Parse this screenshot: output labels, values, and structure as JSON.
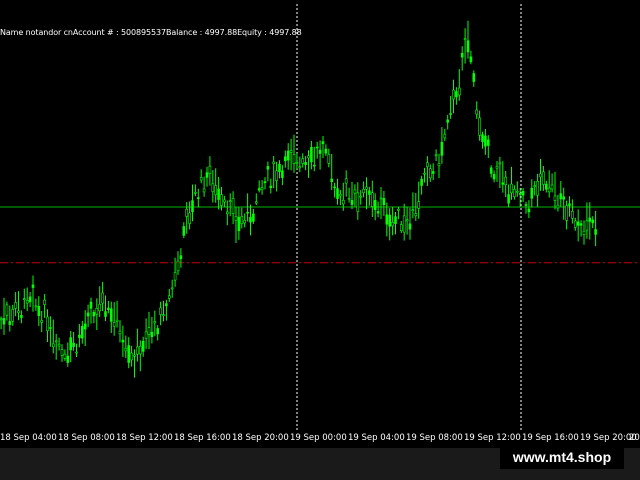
{
  "account_info": {
    "name_label": "Name",
    "name_value": "notandor cn",
    "account_label": "Account #",
    "account_value": "500895537",
    "balance_label": "Balance",
    "balance_value": "4997.88",
    "equity_label": "Equity",
    "equity_value": "4997.88"
  },
  "watermark": "www.mt4.shop",
  "colors": {
    "background": "#000000",
    "candles": "#00ff00",
    "horizontal_line": "#00b400",
    "level_line": "#cc0000",
    "grid_marker": "#ffffff"
  },
  "chart_data": {
    "type": "line",
    "x_ticks": [
      "18 Sep 04:00",
      "18 Sep 08:00",
      "18 Sep 12:00",
      "18 Sep 16:00",
      "18 Sep 20:00",
      "19 Sep 00:00",
      "19 Sep 04:00",
      "19 Sep 08:00",
      "19 Sep 12:00",
      "19 Sep 16:00",
      "19 Sep 20:00",
      "20"
    ],
    "x": [
      "18 Sep 03:00",
      "18 Sep 04:00",
      "18 Sep 05:00",
      "18 Sep 06:00",
      "18 Sep 07:00",
      "18 Sep 08:00",
      "18 Sep 09:00",
      "18 Sep 10:00",
      "18 Sep 11:00",
      "18 Sep 12:00",
      "18 Sep 13:00",
      "18 Sep 14:00",
      "18 Sep 15:00",
      "18 Sep 16:00",
      "18 Sep 17:00",
      "18 Sep 18:00",
      "18 Sep 19:00",
      "18 Sep 20:00",
      "18 Sep 21:00",
      "18 Sep 22:00",
      "18 Sep 23:00",
      "19 Sep 00:00",
      "19 Sep 01:00",
      "19 Sep 02:00",
      "19 Sep 03:00",
      "19 Sep 04:00",
      "19 Sep 05:00",
      "19 Sep 06:00",
      "19 Sep 07:00",
      "19 Sep 08:00",
      "19 Sep 09:00",
      "19 Sep 10:00",
      "19 Sep 11:00",
      "19 Sep 12:00",
      "19 Sep 13:00",
      "19 Sep 14:00",
      "19 Sep 15:00",
      "19 Sep 16:00",
      "19 Sep 17:00",
      "19 Sep 18:00",
      "19 Sep 19:00",
      "19 Sep 20:00",
      "19 Sep 21:00"
    ],
    "y": [
      0.18,
      0.22,
      0.25,
      0.3,
      0.2,
      0.0,
      0.05,
      0.2,
      0.3,
      0.15,
      -0.05,
      0.1,
      0.2,
      0.55,
      0.95,
      1.1,
      1.0,
      0.8,
      0.85,
      1.05,
      1.15,
      1.2,
      1.22,
      1.25,
      1.0,
      1.0,
      0.95,
      0.9,
      0.8,
      0.85,
      1.05,
      1.2,
      1.55,
      1.95,
      1.3,
      1.1,
      1.0,
      0.9,
      1.05,
      1.0,
      0.85,
      0.8,
      0.75
    ],
    "h_line": 0.9,
    "level_line": 0.55,
    "ylim": [
      -0.5,
      2.2
    ]
  }
}
